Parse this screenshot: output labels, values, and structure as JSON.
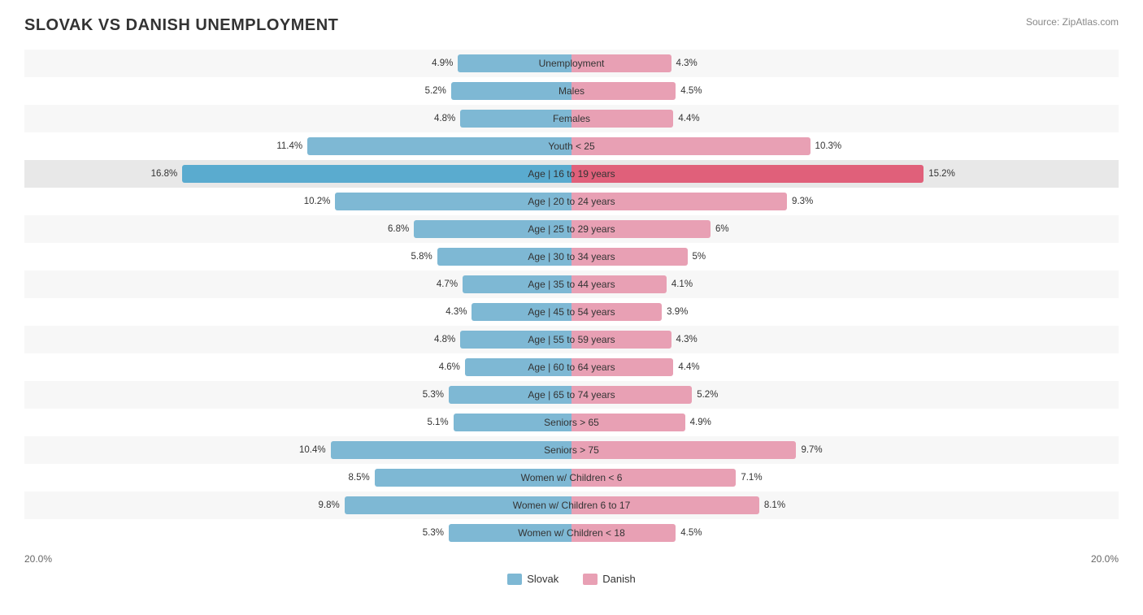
{
  "title": "SLOVAK VS DANISH UNEMPLOYMENT",
  "source": "Source: ZipAtlas.com",
  "legend": {
    "slovak_label": "Slovak",
    "danish_label": "Danish",
    "slovak_color": "#7eb8d4",
    "danish_color": "#e8a0b4"
  },
  "x_axis": {
    "left": "20.0%",
    "right": "20.0%"
  },
  "max_value": 20.0,
  "rows": [
    {
      "label": "Unemployment",
      "slovak": 4.9,
      "danish": 4.3,
      "highlight": false
    },
    {
      "label": "Males",
      "slovak": 5.2,
      "danish": 4.5,
      "highlight": false
    },
    {
      "label": "Females",
      "slovak": 4.8,
      "danish": 4.4,
      "highlight": false
    },
    {
      "label": "Youth < 25",
      "slovak": 11.4,
      "danish": 10.3,
      "highlight": false
    },
    {
      "label": "Age | 16 to 19 years",
      "slovak": 16.8,
      "danish": 15.2,
      "highlight": true
    },
    {
      "label": "Age | 20 to 24 years",
      "slovak": 10.2,
      "danish": 9.3,
      "highlight": false
    },
    {
      "label": "Age | 25 to 29 years",
      "slovak": 6.8,
      "danish": 6.0,
      "highlight": false
    },
    {
      "label": "Age | 30 to 34 years",
      "slovak": 5.8,
      "danish": 5.0,
      "highlight": false
    },
    {
      "label": "Age | 35 to 44 years",
      "slovak": 4.7,
      "danish": 4.1,
      "highlight": false
    },
    {
      "label": "Age | 45 to 54 years",
      "slovak": 4.3,
      "danish": 3.9,
      "highlight": false
    },
    {
      "label": "Age | 55 to 59 years",
      "slovak": 4.8,
      "danish": 4.3,
      "highlight": false
    },
    {
      "label": "Age | 60 to 64 years",
      "slovak": 4.6,
      "danish": 4.4,
      "highlight": false
    },
    {
      "label": "Age | 65 to 74 years",
      "slovak": 5.3,
      "danish": 5.2,
      "highlight": false
    },
    {
      "label": "Seniors > 65",
      "slovak": 5.1,
      "danish": 4.9,
      "highlight": false
    },
    {
      "label": "Seniors > 75",
      "slovak": 10.4,
      "danish": 9.7,
      "highlight": false
    },
    {
      "label": "Women w/ Children < 6",
      "slovak": 8.5,
      "danish": 7.1,
      "highlight": false
    },
    {
      "label": "Women w/ Children 6 to 17",
      "slovak": 9.8,
      "danish": 8.1,
      "highlight": false
    },
    {
      "label": "Women w/ Children < 18",
      "slovak": 5.3,
      "danish": 4.5,
      "highlight": false
    }
  ]
}
